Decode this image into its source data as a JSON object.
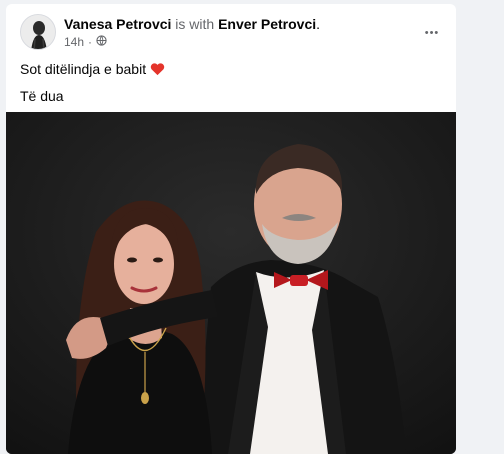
{
  "post": {
    "author": "Vanesa Petrovci",
    "with_text": "is with",
    "tagged": "Enver Petrovci",
    "tagged_suffix": ".",
    "time": "14h",
    "dot": "·",
    "privacy_icon": "globe-icon",
    "more_icon": "more-horizontal-icon",
    "more_label": "•••",
    "line1": "Sot ditëlindja e babit",
    "emoji": "red-heart-emoji",
    "line2": "Të dua"
  },
  "colors": {
    "primary_text": "#050505",
    "secondary_text": "#65676b",
    "heart": "#e4342b",
    "page_bg": "#f0f2f5",
    "card_bg": "#ffffff"
  }
}
